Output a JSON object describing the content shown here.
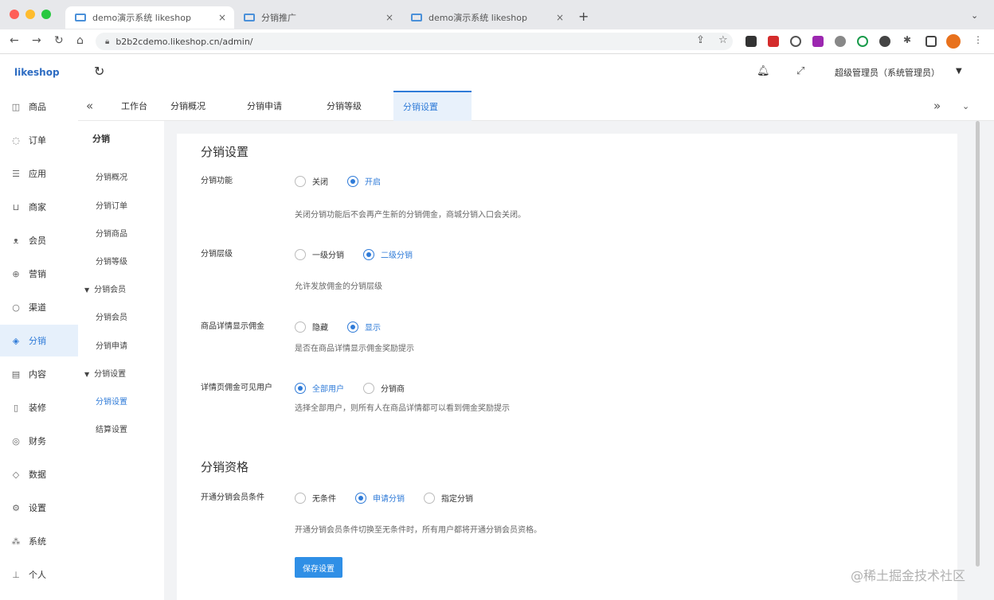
{
  "browser": {
    "tabs": [
      {
        "title": "demo演示系统 likeshop",
        "close": "×"
      },
      {
        "title": "分销推广",
        "close": "×"
      },
      {
        "title": "demo演示系统 likeshop",
        "close": "×"
      }
    ],
    "new_tab": "+",
    "tab_menu": "⌄",
    "url": "b2b2cdemo.likeshop.cn/admin/",
    "colors": {
      "close": "#ff5f57",
      "min": "#febc2e",
      "max": "#28c840"
    }
  },
  "app": {
    "logo": "likeshop",
    "user": "超级管理员（系统管理员）",
    "sidebar": [
      {
        "label": "商品",
        "icon": "bag-icon"
      },
      {
        "label": "订单",
        "icon": "order-icon"
      },
      {
        "label": "应用",
        "icon": "apps-icon"
      },
      {
        "label": "商家",
        "icon": "shop-icon"
      },
      {
        "label": "会员",
        "icon": "user-icon"
      },
      {
        "label": "营销",
        "icon": "marketing-icon"
      },
      {
        "label": "渠道",
        "icon": "channel-icon"
      },
      {
        "label": "分销",
        "icon": "distribution-icon"
      },
      {
        "label": "内容",
        "icon": "content-icon"
      },
      {
        "label": "装修",
        "icon": "decorate-icon"
      },
      {
        "label": "财务",
        "icon": "finance-icon"
      },
      {
        "label": "数据",
        "icon": "data-icon"
      },
      {
        "label": "设置",
        "icon": "settings-icon"
      },
      {
        "label": "系统",
        "icon": "system-icon"
      },
      {
        "label": "个人",
        "icon": "person-icon"
      }
    ],
    "top_tabs": [
      "工作台",
      "分销概况",
      "分销申请",
      "分销等级",
      "分销设置"
    ],
    "subnav": {
      "head": "分销",
      "items": [
        "分销概况",
        "分销订单",
        "分销商品",
        "分销等级"
      ],
      "group1": "分销会员",
      "group1_items": [
        "分销会员",
        "分销申请"
      ],
      "group2": "分销设置",
      "group2_items": [
        "分销设置"
      ],
      "last": "结算设置"
    }
  },
  "form": {
    "section1": "分销设置",
    "fields": [
      {
        "label": "分销功能",
        "options": [
          "关闭",
          "开启"
        ],
        "selected": 1,
        "hint": "关闭分销功能后不会再产生新的分销佣金，商城分销入口会关闭。"
      },
      {
        "label": "分销层级",
        "options": [
          "一级分销",
          "二级分销"
        ],
        "selected": 1,
        "hint": "允许发放佣金的分销层级"
      },
      {
        "label": "商品详情显示佣金",
        "options": [
          "隐藏",
          "显示"
        ],
        "selected": 1,
        "hint": "是否在商品详情显示佣金奖励提示"
      },
      {
        "label": "详情页佣金可见用户",
        "options": [
          "全部用户",
          "分销商"
        ],
        "selected": 0,
        "hint": "选择全部用户，则所有人在商品详情都可以看到佣金奖励提示"
      }
    ],
    "section2": "分销资格",
    "qual": {
      "label": "开通分销会员条件",
      "options": [
        "无条件",
        "申请分销",
        "指定分销"
      ],
      "selected": 1,
      "hint": "开通分销会员条件切换至无条件时，所有用户都将开通分销会员资格。"
    },
    "save": "保存设置"
  },
  "watermark": "@稀土掘金技术社区"
}
